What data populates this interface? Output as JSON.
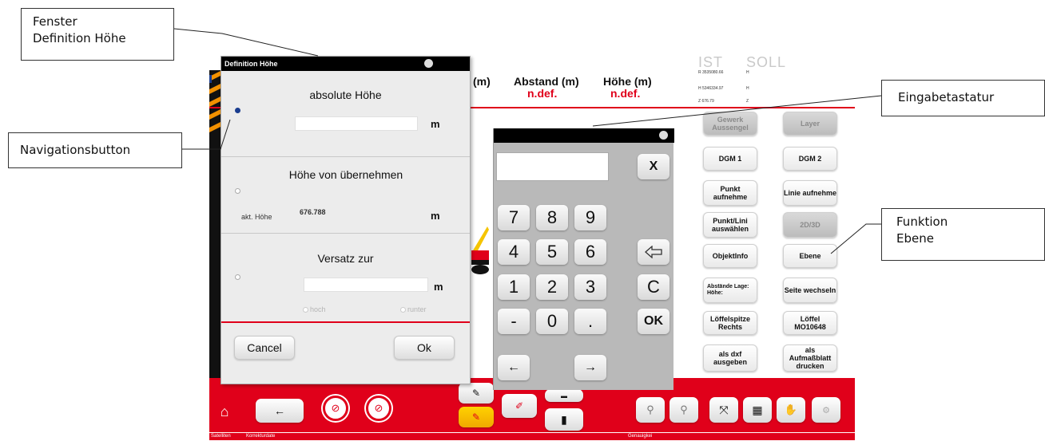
{
  "callouts": {
    "fenster_line1": "Fenster",
    "fenster_line2": "Definition Höhe",
    "navigation": "Navigationsbutton",
    "eingabe": "Eingabetastatur",
    "funktion_line1": "Funktion",
    "funktion_line2": "Ebene"
  },
  "header": {
    "partial_unit": "(m)",
    "abstand_label": "Abstand (m)",
    "abstand_value": "n.def.",
    "hoehe_label": "Höhe (m)",
    "hoehe_value": "n.def.",
    "ist": "IST",
    "soll": "SOLL",
    "coord_r": "R 3535080.66",
    "coord_r_suffix": "H",
    "coord_h": "H 5346334.97",
    "coord_h_suffix": "H",
    "coord_z": "Z 676.79",
    "coord_z_suffix": "Z"
  },
  "function_buttons": [
    {
      "label": "Gewerk Aussengel",
      "enabled": false
    },
    {
      "label": "Layer",
      "enabled": false
    },
    {
      "label": "DGM 1",
      "enabled": true
    },
    {
      "label": "DGM 2",
      "enabled": true
    },
    {
      "label": "Punkt aufnehme",
      "enabled": true
    },
    {
      "label": "Linie aufnehme",
      "enabled": true
    },
    {
      "label": "Punkt/Lini auswählen",
      "enabled": true
    },
    {
      "label": "2D/3D",
      "enabled": false
    },
    {
      "label": "ObjektInfo",
      "enabled": true
    },
    {
      "label": "Ebene",
      "enabled": true
    },
    {
      "label": "Abstände Lage: Höhe:",
      "enabled": true
    },
    {
      "label": "Seite wechseln",
      "enabled": true
    },
    {
      "label": "Löffelspitze Rechts",
      "enabled": true
    },
    {
      "label": "Löffel MO10648",
      "enabled": true
    },
    {
      "label": "als dxf ausgeben",
      "enabled": true
    },
    {
      "label": "als Aufmaßblatt drucken",
      "enabled": true
    }
  ],
  "dialog": {
    "title": "Definition Höhe",
    "absolute_label": "absolute Höhe",
    "absolute_value": "",
    "unit": "m",
    "from_label": "Höhe von übernehmen",
    "current_label": "akt. Höhe",
    "current_value": "676.788",
    "offset_label": "Versatz zur",
    "offset_value": "",
    "up_label": "hoch",
    "down_label": "runter",
    "selected_option": "absolute Höhe",
    "cancel": "Cancel",
    "ok": "Ok"
  },
  "keypad": {
    "display_value": "",
    "clear_all": "X",
    "keys": [
      "7",
      "8",
      "9",
      "4",
      "5",
      "6",
      "1",
      "2",
      "3",
      "-",
      "0",
      "."
    ],
    "backspace_icon": "backspace-arrow-icon",
    "clear": "C",
    "ok": "OK",
    "left_arrow": "←",
    "right_arrow": "→"
  },
  "bottombar": {
    "back_arrow": "←",
    "status_satelliten": "Satelliten",
    "status_korrekturdate": "Korrekturdate",
    "status_genauigkeit": "Genauigkei"
  },
  "colors": {
    "accent_red": "#e0001a",
    "titlebar": "#000000",
    "keypad_bg": "#b9b9b9",
    "selected_radio": "#1a3d8f"
  }
}
